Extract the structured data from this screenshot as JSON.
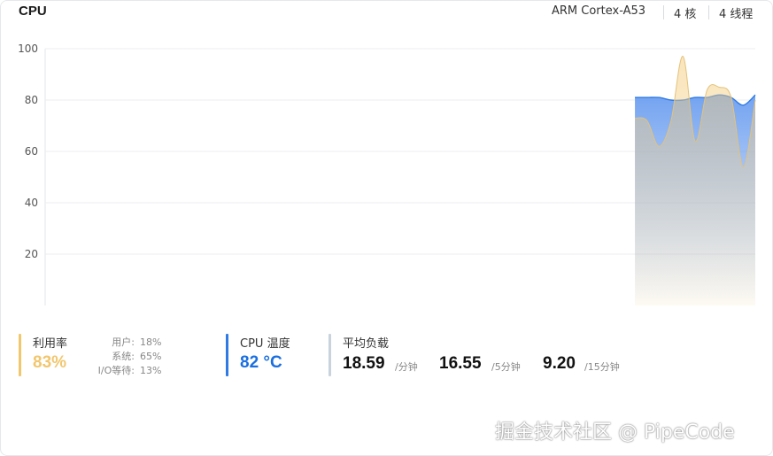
{
  "header": {
    "title": "CPU",
    "cpu_model": "ARM Cortex-A53",
    "cores": "4 核",
    "threads": "4 线程"
  },
  "colors": {
    "usage": "#f2c66d",
    "temperature": "#2f7ae5",
    "load_bar": "#c9d3de",
    "grid": "#eceef1"
  },
  "chart_data": {
    "type": "area",
    "ylim": [
      0,
      100
    ],
    "yticks": [
      "100",
      "80",
      "60",
      "40",
      "20"
    ],
    "x_count": 60,
    "series": [
      {
        "key": "temperature",
        "color": "#2f7ae5",
        "x": [
          49,
          50,
          51,
          52,
          53,
          54,
          55,
          56,
          57,
          58,
          59
        ],
        "values": [
          81,
          81,
          81,
          80,
          80,
          81,
          81,
          82,
          81,
          78,
          82
        ]
      },
      {
        "key": "usage",
        "color": "#f2c66d",
        "x": [
          49,
          50,
          51,
          52,
          53,
          54,
          55,
          56,
          57,
          58,
          59
        ],
        "values": [
          73,
          72,
          62,
          72,
          97,
          64,
          84,
          85,
          81,
          54,
          80
        ]
      }
    ]
  },
  "stats": {
    "usage": {
      "label": "利用率",
      "value": "83%",
      "details": [
        {
          "label": "用户:",
          "value": "18%"
        },
        {
          "label": "系统:",
          "value": "65%"
        },
        {
          "label": "I/O等待:",
          "value": "13%"
        }
      ]
    },
    "temperature": {
      "label": "CPU 温度",
      "value": "82 °C"
    },
    "load": {
      "label": "平均负载",
      "items": [
        {
          "value": "18.59",
          "unit": "/分钟"
        },
        {
          "value": "16.55",
          "unit": "/5分钟"
        },
        {
          "value": "9.20",
          "unit": "/15分钟"
        }
      ]
    }
  },
  "watermark": "掘金技术社区 @ PipeCode"
}
